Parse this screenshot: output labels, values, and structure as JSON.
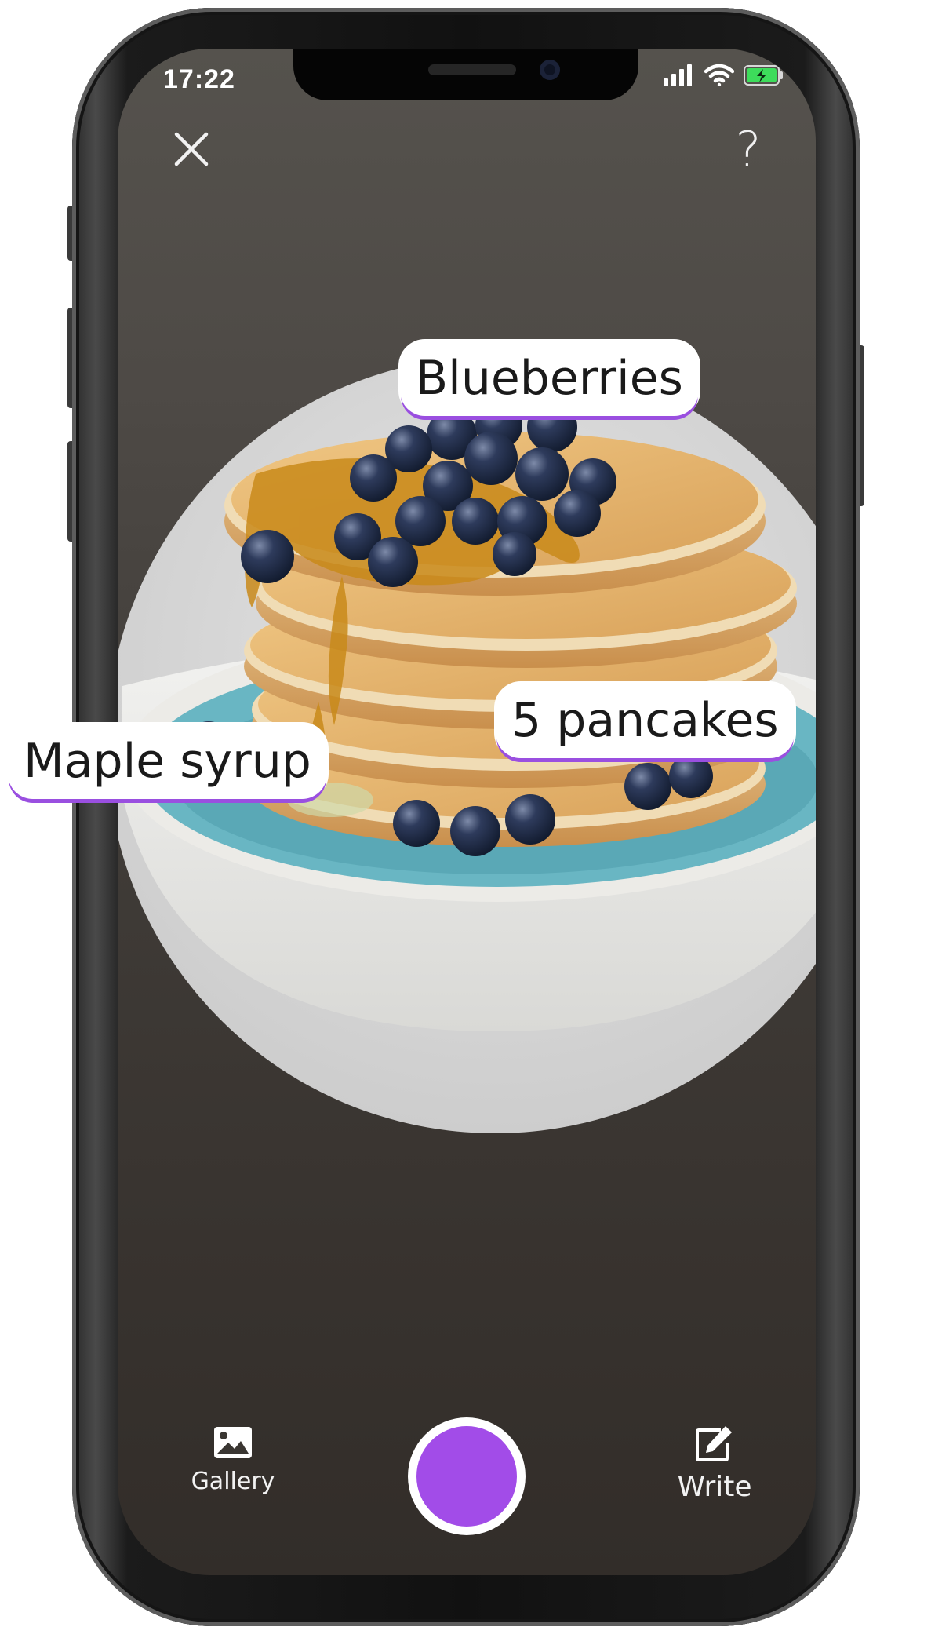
{
  "status_bar": {
    "time": "17:22",
    "icons": [
      "cellular-signal-icon",
      "wifi-icon",
      "battery-charging-icon"
    ],
    "battery_color": "#3ddc5b"
  },
  "toolbar": {
    "close_icon": "close-icon",
    "help_label": "?"
  },
  "scan": {
    "image": "pancake-stack-with-blueberries",
    "labels": {
      "blueberries": "Blueberries",
      "pancakes": "5 pancakes",
      "syrup": "Maple syrup"
    }
  },
  "bottom_bar": {
    "gallery_label": "Gallery",
    "write_label": "Write",
    "shutter_color": "#a24ce8"
  },
  "colors": {
    "accent": "#9a4fe0",
    "label_bg": "#ffffff"
  }
}
